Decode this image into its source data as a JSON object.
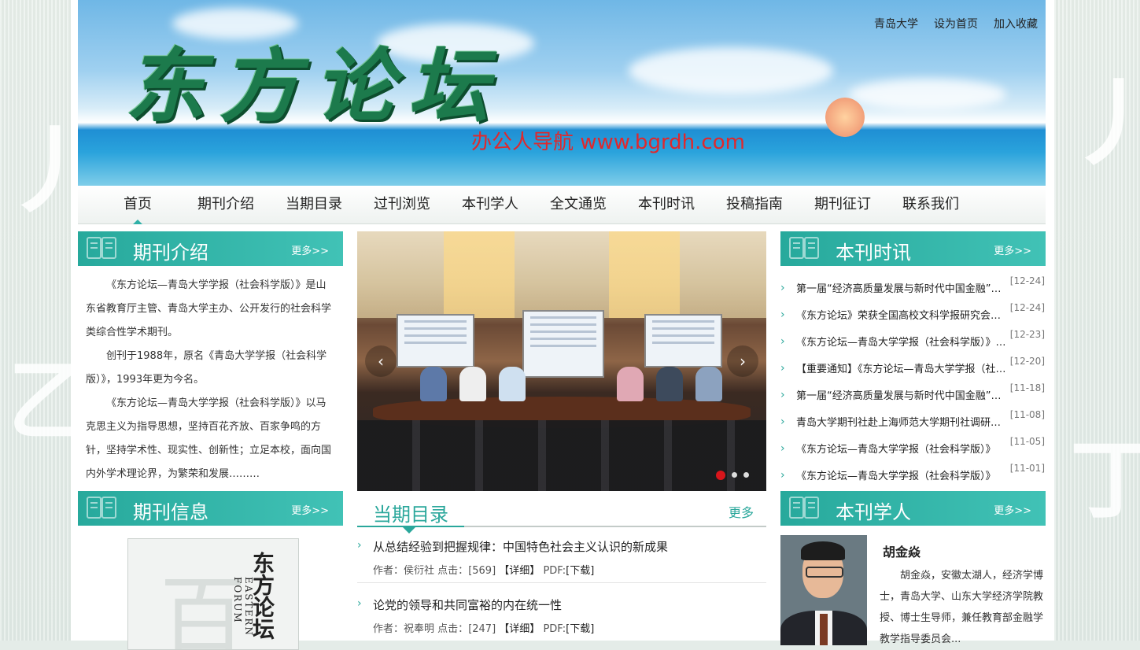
{
  "site": {
    "logo_text": "东方论坛",
    "watermark": "办公人导航 www.bgrdh.com",
    "top_links": [
      "青岛大学",
      "设为首页",
      "加入收藏"
    ]
  },
  "nav": {
    "items": [
      "首页",
      "期刊介绍",
      "当期目录",
      "过刊浏览",
      "本刊学人",
      "全文通览",
      "本刊时讯",
      "投稿指南",
      "期刊征订",
      "联系我们"
    ],
    "active_index": 0
  },
  "intro": {
    "title": "期刊介绍",
    "more": "更多>>",
    "paragraphs": [
      "《东方论坛—青岛大学学报（社会科学版）》是山东省教育厅主管、青岛大学主办、公开发行的社会科学类综合性学术期刊。",
      "创刊于1988年，原名《青岛大学学报（社会科学版）》，1993年更为今名。",
      "《东方论坛—青岛大学学报（社会科学版）》以马克思主义为指导思想，坚持百花齐放、百家争鸣的方针，坚持学术性、现实性、创新性；立足本校，面向国内外学术理论界，为繁荣和发展………"
    ]
  },
  "info": {
    "title": "期刊信息",
    "more": "更多>>",
    "cover_title": "东方论坛",
    "cover_en": "EASTERN FORUM"
  },
  "slider": {
    "prev": "‹",
    "next": "›",
    "active_dot": 0,
    "dots": 3
  },
  "current_issue": {
    "title": "当期目录",
    "more": "更多",
    "articles": [
      {
        "title": "从总结经验到把握规律：中国特色社会主义认识的新成果",
        "author_label": "作者：",
        "author": "侯衍社",
        "clicks_label": "点击：",
        "clicks": "[569]",
        "detail": "【详细】",
        "pdf_label": "PDF:",
        "download": "[下载]"
      },
      {
        "title": "论党的领导和共同富裕的内在统一性",
        "author_label": "作者：",
        "author": "祝奉明",
        "clicks_label": "点击：",
        "clicks": "[247]",
        "detail": "【详细】",
        "pdf_label": "PDF:",
        "download": "[下载]"
      }
    ]
  },
  "news": {
    "title": "本刊时讯",
    "more": "更多>>",
    "items": [
      {
        "text": "第一届“经济高质量发展与新时代中国金融”学术研讨会",
        "date": "[12-24]"
      },
      {
        "text": "《东方论坛》荣获全国高校文科学报研究会优秀编辑奖",
        "date": "[12-24]"
      },
      {
        "text": "《东方论坛—青岛大学学报（社会科学版）》入选",
        "date": "[12-23]"
      },
      {
        "text": "【重要通知】《东方论坛—青岛大学学报（社会科学版）》",
        "date": "[12-20]"
      },
      {
        "text": "第一届“经济高质量发展与新时代中国金融”学术研讨会",
        "date": "[11-18]"
      },
      {
        "text": "青岛大学期刊社赴上海师范大学期刊社调研交流",
        "date": "[11-08]"
      },
      {
        "text": "《东方论坛—青岛大学学报（社会科学版）》",
        "date": "[11-05]"
      },
      {
        "text": "《东方论坛—青岛大学学报（社会科学版）》",
        "date": "[11-01]"
      }
    ]
  },
  "scholar": {
    "title": "本刊学人",
    "more": "更多>>",
    "name": "胡金焱",
    "desc": "胡金焱，安徽太湖人，经济学博士，青岛大学、山东大学经济学院教授、博士生导师，兼任教育部金融学教学指导委员会..."
  },
  "colors": {
    "accent": "#2aa79b",
    "header_teal": "#41c2b6",
    "red_dot": "#d8151b"
  }
}
